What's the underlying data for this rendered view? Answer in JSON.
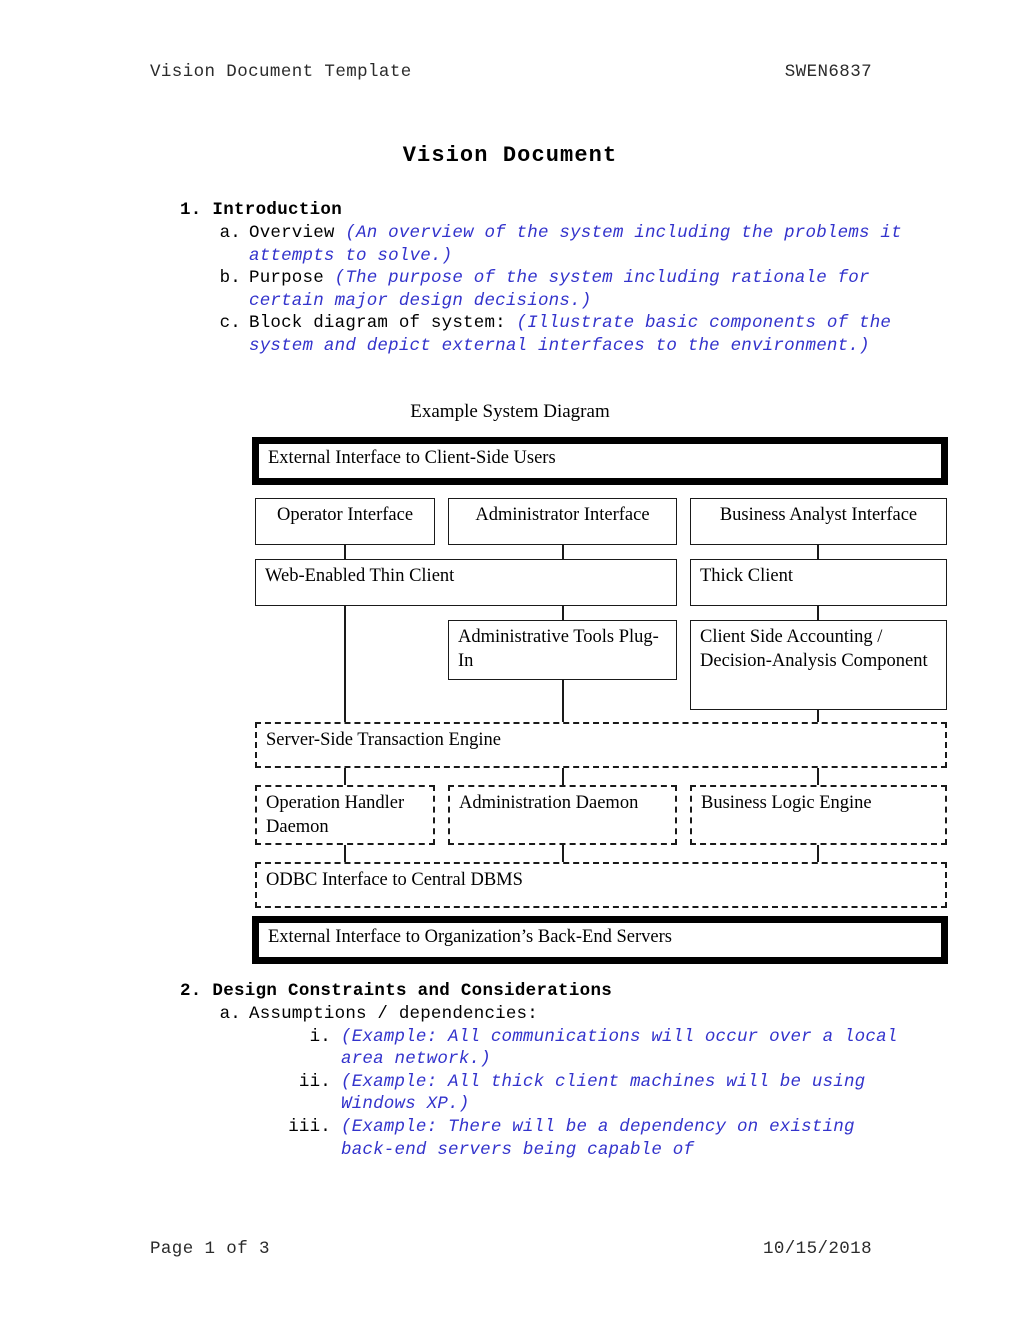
{
  "header": {
    "left": "Vision Document Template",
    "right": "SWEN6837"
  },
  "footer": {
    "left": "Page 1 of 3",
    "right": "10/15/2018"
  },
  "title": "Vision Document",
  "sections": {
    "one": {
      "heading": "1. Introduction",
      "items": [
        {
          "marker": "a.",
          "lead": "Overview ",
          "example": "(An overview of the system including the problems it attempts to solve.)"
        },
        {
          "marker": "b.",
          "lead": "Purpose ",
          "example": "(The purpose of the system including rationale for certain major design decisions.)"
        },
        {
          "marker": "c.",
          "lead": "Block diagram of system: ",
          "example": "(Illustrate basic components of the system and depict external interfaces to the environment.)"
        }
      ]
    },
    "two": {
      "heading": "2. Design Constraints and Considerations",
      "items": [
        {
          "marker": "a.",
          "lead": "Assumptions / dependencies:",
          "example": ""
        }
      ],
      "subitems": [
        {
          "marker": "i.",
          "example": "(Example: All communications will occur over a local area network.)"
        },
        {
          "marker": "ii.",
          "example": "(Example: All thick client machines will be using Windows XP.)"
        },
        {
          "marker": "iii.",
          "example": "(Example: There will be a dependency on existing back-end servers being capable of"
        }
      ]
    }
  },
  "figure": {
    "caption": "Example System Diagram",
    "nodes": {
      "external_client": "External Interface to Client-Side Users",
      "operator_interface": "Operator Interface",
      "administrator_interface": "Administrator Interface",
      "business_analyst_interface": "Business Analyst Interface",
      "thin_client": "Web-Enabled Thin Client",
      "thick_client": "Thick Client",
      "admin_tools": "Administrative Tools Plug-In",
      "admin_tools_line1": "Administrative Tools",
      "admin_tools_line2": "Plug-In",
      "client_accounting": "Client Side Accounting / Decision-Analysis Component",
      "client_accounting_line1": "Client Side Accounting /",
      "client_accounting_line2": "Decision-Analysis",
      "client_accounting_line3": "Component",
      "transaction_engine": "Server-Side Transaction Engine",
      "operation_handler": "Operation Handler Daemon",
      "operation_handler_line1": "Operation Handler",
      "operation_handler_line2": "Daemon",
      "administration_daemon": "Administration Daemon",
      "business_logic": "Business Logic Engine",
      "odbc": "ODBC Interface to Central DBMS",
      "external_backend": "External Interface to Organization’s Back-End Servers"
    }
  },
  "colors": {
    "example_text": "#3333cc",
    "rule": "#1a1a1a",
    "emphasis_border": "#000000"
  }
}
